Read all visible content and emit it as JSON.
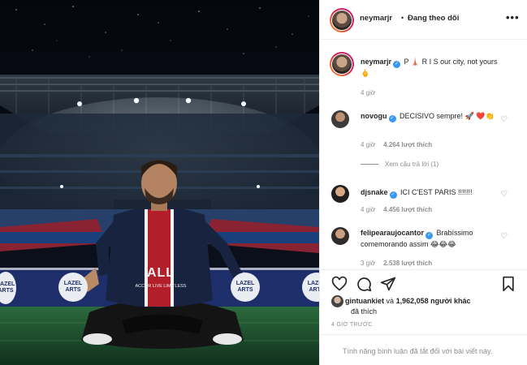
{
  "post": {
    "username": "neymarjr",
    "follow_status": "Đang theo dõi",
    "dot": "•",
    "more_icon": "more-horizontal-icon"
  },
  "photo": {
    "banner_left": "LAZEL\nARTS",
    "banner_mid": "LAZEL\nARTS",
    "banner_right_a": "LAZEL\nARTS",
    "banner_right_b": "LAZEL\nARTS",
    "jersey_brand": "ALL",
    "jersey_sub": "ACCOR LIVE LIMITLESS"
  },
  "caption": {
    "username": "neymarjr",
    "text": "P 🗼 R I S our city, not yours 🖕",
    "time": "4 giờ"
  },
  "comments": [
    {
      "username": "novogu",
      "text": "DECISIVO sempre! 🚀 ❤️👏",
      "time": "4 giờ",
      "likes": "4.264 lượt thích",
      "replies": "Xem câu trả lời (1)"
    },
    {
      "username": "djsnake",
      "text": "ICI C'EST PARIS !!!!!!!",
      "time": "4 giờ",
      "likes": "4.456 lượt thích"
    },
    {
      "username": "felipearaujocantor",
      "text": "Brabíssimo comemorando assim 😂😂😂",
      "time": "3 giờ",
      "likes": "2.538 lượt thích"
    }
  ],
  "likes_summary": {
    "user": "gintuankiet",
    "joiner": "và",
    "others": "1,962,058 người khác",
    "tail": "đã thích"
  },
  "timestamp": "4 GIỜ TRƯỚC",
  "comments_disabled": "Tính năng bình luận đã tắt đối với bài viết này.",
  "colors": {
    "verified": "#3897f0",
    "meta": "#8e8e8e",
    "pitch": "#1c4a2a",
    "stand_red": "#8a2331"
  }
}
